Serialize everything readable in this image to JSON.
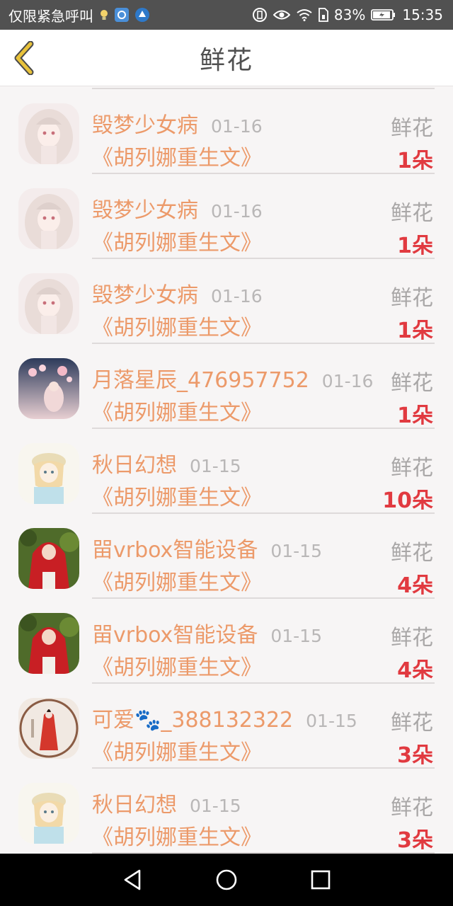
{
  "status_bar": {
    "carrier": "仅限紧急呼叫",
    "battery_percent": "83%",
    "time": "15:35",
    "icons": [
      "bulb-icon",
      "app-icon-blue",
      "app-icon-full",
      "vibrate-icon",
      "eye-icon",
      "wifi-icon",
      "sim-icon",
      "battery-icon"
    ]
  },
  "header": {
    "title": "鲜花",
    "back_icon": "chevron-left-icon"
  },
  "list": {
    "rows": [
      {
        "user": "毁梦少女病",
        "date": "01-16",
        "type": "鲜花",
        "book": "《胡列娜重生文》",
        "count": "1朵",
        "avatar": "pink-hair-girl"
      },
      {
        "user": "毁梦少女病",
        "date": "01-16",
        "type": "鲜花",
        "book": "《胡列娜重生文》",
        "count": "1朵",
        "avatar": "pink-hair-girl"
      },
      {
        "user": "毁梦少女病",
        "date": "01-16",
        "type": "鲜花",
        "book": "《胡列娜重生文》",
        "count": "1朵",
        "avatar": "pink-hair-girl"
      },
      {
        "user": "月落星辰_476957752",
        "date": "01-16",
        "type": "鲜花",
        "book": "《胡列娜重生文》",
        "count": "1朵",
        "avatar": "blossom-girl"
      },
      {
        "user": "秋日幻想",
        "date": "01-15",
        "type": "鲜花",
        "book": "《胡列娜重生文》",
        "count": "10朵",
        "avatar": "hat-girl"
      },
      {
        "user": "㽞vrbox智能设备",
        "date": "01-15",
        "type": "鲜花",
        "book": "《胡列娜重生文》",
        "count": "4朵",
        "avatar": "red-hood-girl"
      },
      {
        "user": "㽞vrbox智能设备",
        "date": "01-15",
        "type": "鲜花",
        "book": "《胡列娜重生文》",
        "count": "4朵",
        "avatar": "red-hood-girl"
      },
      {
        "user": "可爱🐾_388132322",
        "date": "01-15",
        "type": "鲜花",
        "book": "《胡列娜重生文》",
        "count": "3朵",
        "avatar": "red-robe-lady"
      },
      {
        "user": "秋日幻想",
        "date": "01-15",
        "type": "鲜花",
        "book": "《胡列娜重生文》",
        "count": "3朵",
        "avatar": "hat-girl"
      }
    ]
  },
  "nav_bar": {
    "icons": [
      "back-triangle-icon",
      "home-circle-icon",
      "recents-square-icon"
    ]
  },
  "colors": {
    "accent_orange": "#ec9a6a",
    "count_red": "#e13a40",
    "back_yellow": "#e8c23a"
  }
}
